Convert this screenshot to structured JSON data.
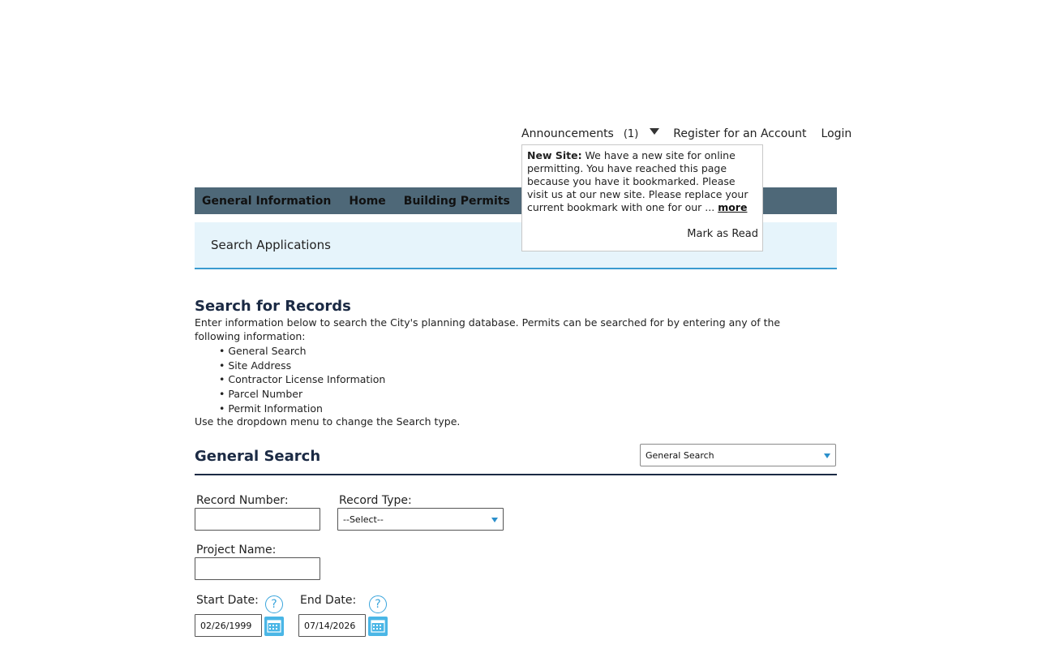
{
  "top_links": {
    "announcements": "Announcements",
    "announcements_count": "(1)",
    "register": "Register for an Account",
    "login": "Login"
  },
  "nav": {
    "items": [
      "General Information",
      "Home",
      "Building Permits"
    ]
  },
  "subheader": {
    "title": "Search Applications"
  },
  "popup": {
    "title": "New Site:",
    "body": " We have a new site for online permitting. You have reached this page because you have it bookmarked. Please visit us at our new site. Please replace your current bookmark with one for our ... ",
    "more": "more",
    "mark_read": "Mark as Read"
  },
  "main": {
    "title": "Search for Records",
    "intro": "Enter information below to search the City's planning database. Permits can be searched for by entering any of the following information:",
    "bullets": [
      "General Search",
      "Site Address",
      "Contractor License Information",
      "Parcel Number",
      "Permit Information"
    ],
    "note": "Use the dropdown menu to change the Search type."
  },
  "section": {
    "title": "General Search",
    "search_type_value": "General Search"
  },
  "form": {
    "record_number_label": "Record Number:",
    "record_number_value": "",
    "record_type_label": "Record Type:",
    "record_type_value": "--Select--",
    "project_name_label": "Project Name:",
    "project_name_value": "",
    "start_date_label": "Start Date:",
    "start_date_value": "02/26/1999",
    "end_date_label": "End Date:",
    "end_date_value": "07/14/2026",
    "help_glyph": "?"
  },
  "colors": {
    "nav_bg": "#4e6878",
    "subheader_bg": "#e6f4fb",
    "accent_blue": "#3a9bd0",
    "heading": "#1b2a44"
  }
}
